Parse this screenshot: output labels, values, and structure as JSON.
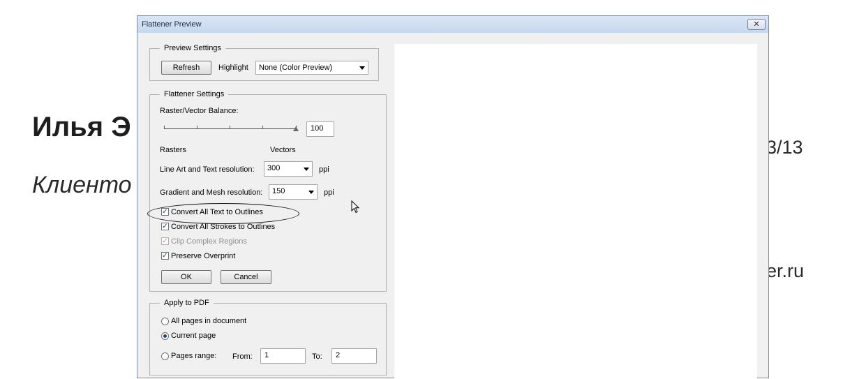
{
  "background": {
    "title": "Илья Э",
    "subtitle": "Клиенто",
    "page": "3/13",
    "site": "er.ru"
  },
  "dialog": {
    "title": "Flattener Preview",
    "close_label": "✕",
    "preview_settings": {
      "legend": "Preview Settings",
      "refresh_label": "Refresh",
      "highlight_label": "Highlight",
      "highlight_value": "None (Color Preview)"
    },
    "flattener_settings": {
      "legend": "Flattener Settings",
      "balance_label": "Raster/Vector Balance:",
      "balance_value": "100",
      "rasters_label": "Rasters",
      "vectors_label": "Vectors",
      "line_art_label": "Line Art and Text resolution:",
      "line_art_value": "300",
      "gradient_label": "Gradient and Mesh resolution:",
      "gradient_value": "150",
      "ppi_label": "ppi",
      "checkboxes": [
        {
          "label": "Convert All Text to Outlines",
          "checked": true,
          "disabled": false
        },
        {
          "label": "Convert All Strokes to Outlines",
          "checked": true,
          "disabled": false
        },
        {
          "label": "Clip Complex Regions",
          "checked": true,
          "disabled": true
        },
        {
          "label": "Preserve Overprint",
          "checked": true,
          "disabled": false
        }
      ],
      "ok_label": "OK",
      "cancel_label": "Cancel"
    },
    "apply_to_pdf": {
      "legend": "Apply to PDF",
      "all_pages_label": "All pages in document",
      "current_page_label": "Current page",
      "selected": "current",
      "range_label": "Pages range:",
      "from_label": "From:",
      "from_value": "1",
      "to_label": "To:",
      "to_value": "2"
    }
  }
}
